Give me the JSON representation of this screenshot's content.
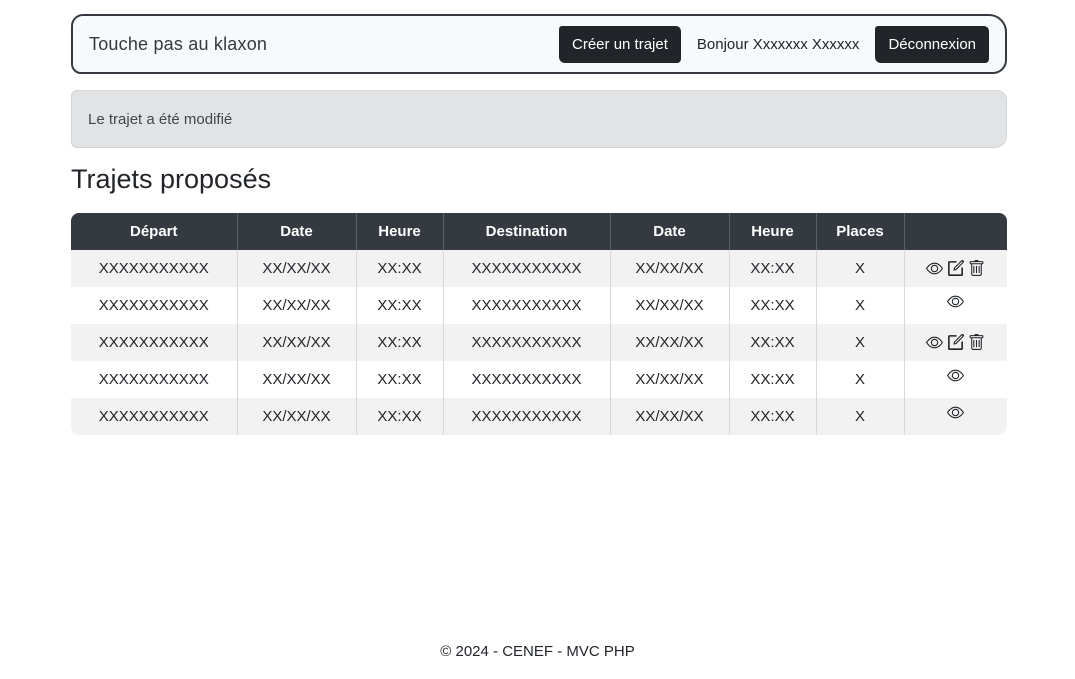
{
  "navbar": {
    "brand": "Touche pas au klaxon",
    "create_button": "Créer un trajet",
    "greeting": "Bonjour Xxxxxxx Xxxxxx",
    "logout_button": "Déconnexion"
  },
  "alert": {
    "message": "Le trajet a été modifié"
  },
  "page_title": "Trajets proposés",
  "table": {
    "headers": [
      "Départ",
      "Date",
      "Heure",
      "Destination",
      "Date",
      "Heure",
      "Places",
      ""
    ],
    "rows": [
      {
        "depart": "XXXXXXXXXXX",
        "date1": "XX/XX/XX",
        "heure1": "XX:XX",
        "destination": "XXXXXXXXXXX",
        "date2": "XX/XX/XX",
        "heure2": "XX:XX",
        "places": "X",
        "actions": [
          "eye-icon",
          "edit-icon",
          "trash-icon"
        ]
      },
      {
        "depart": "XXXXXXXXXXX",
        "date1": "XX/XX/XX",
        "heure1": "XX:XX",
        "destination": "XXXXXXXXXXX",
        "date2": "XX/XX/XX",
        "heure2": "XX:XX",
        "places": "X",
        "actions": [
          "eye-icon"
        ]
      },
      {
        "depart": "XXXXXXXXXXX",
        "date1": "XX/XX/XX",
        "heure1": "XX:XX",
        "destination": "XXXXXXXXXXX",
        "date2": "XX/XX/XX",
        "heure2": "XX:XX",
        "places": "X",
        "actions": [
          "eye-icon",
          "edit-icon",
          "trash-icon"
        ]
      },
      {
        "depart": "XXXXXXXXXXX",
        "date1": "XX/XX/XX",
        "heure1": "XX:XX",
        "destination": "XXXXXXXXXXX",
        "date2": "XX/XX/XX",
        "heure2": "XX:XX",
        "places": "X",
        "actions": [
          "eye-icon"
        ]
      },
      {
        "depart": "XXXXXXXXXXX",
        "date1": "XX/XX/XX",
        "heure1": "XX:XX",
        "destination": "XXXXXXXXXXX",
        "date2": "XX/XX/XX",
        "heure2": "XX:XX",
        "places": "X",
        "actions": [
          "eye-icon"
        ]
      }
    ]
  },
  "footer": {
    "text": "© 2024 - CENEF - MVC PHP"
  },
  "colors": {
    "dark": "#212529",
    "header_bg": "#343a40",
    "alert_bg": "#e2e3e5",
    "stripe": "#f2f2f2"
  }
}
